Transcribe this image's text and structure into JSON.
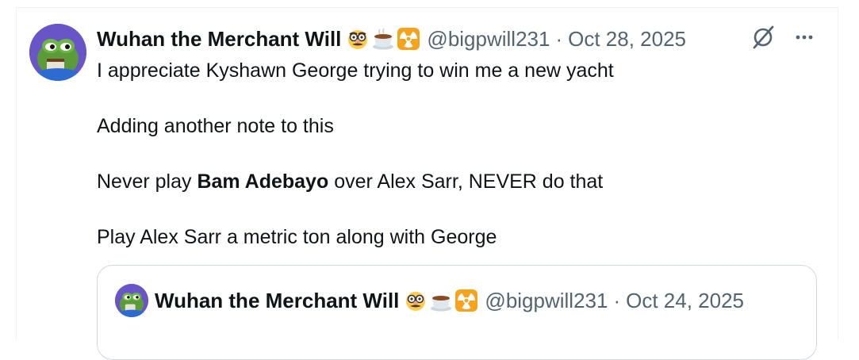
{
  "tweet": {
    "author_name": "Wuhan the Merchant Will",
    "emojis": [
      "disguised-face-emoji",
      "hot-beverage-emoji",
      "radioactive-emoji"
    ],
    "handle": "@bigpwill231",
    "separator": "·",
    "date": "Oct 28, 2025",
    "lines": {
      "line1": "I appreciate Kyshawn George trying to win me a new yacht",
      "line2": "Adding another note to this",
      "line3_pre": "Never play ",
      "line3_bold": "Bam Adebayo",
      "line3_post": " over Alex Sarr, NEVER do that",
      "line4": "Play Alex Sarr a metric ton along with George"
    },
    "actions": [
      "grok-icon",
      "more-icon"
    ]
  },
  "quoted": {
    "author_name": "Wuhan the Merchant Will",
    "handle": "@bigpwill231",
    "separator": "·",
    "date": "Oct 24, 2025"
  },
  "colors": {
    "text": "#0f1419",
    "secondary": "#536471",
    "border": "#cfd9de",
    "avatar_bg": "#6a55c8",
    "radioactive": "#f7a21b"
  }
}
